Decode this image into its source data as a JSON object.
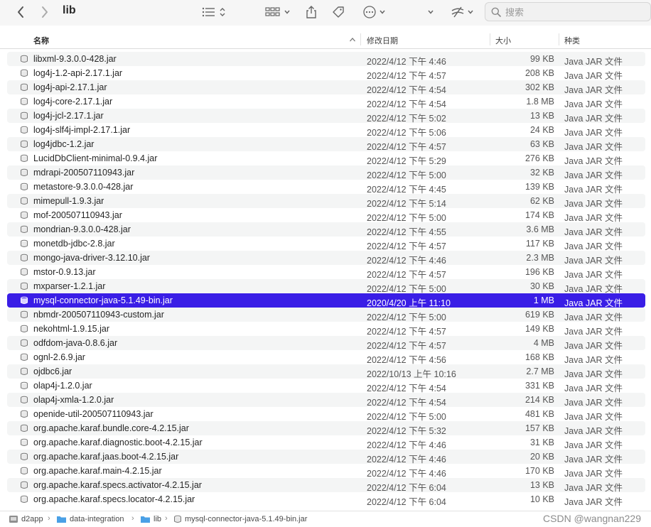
{
  "window": {
    "title": "lib"
  },
  "toolbar": {
    "search_placeholder": "搜索"
  },
  "columns": {
    "name": "名称",
    "date": "修改日期",
    "size": "大小",
    "kind": "种类"
  },
  "files": [
    {
      "name": "libxml-9.3.0.0-428.jar",
      "date": "2022/4/12 下午 4:46",
      "size": "99 KB",
      "kind": "Java JAR 文件"
    },
    {
      "name": "log4j-1.2-api-2.17.1.jar",
      "date": "2022/4/12 下午 4:57",
      "size": "208 KB",
      "kind": "Java JAR 文件"
    },
    {
      "name": "log4j-api-2.17.1.jar",
      "date": "2022/4/12 下午 4:54",
      "size": "302 KB",
      "kind": "Java JAR 文件"
    },
    {
      "name": "log4j-core-2.17.1.jar",
      "date": "2022/4/12 下午 4:54",
      "size": "1.8 MB",
      "kind": "Java JAR 文件"
    },
    {
      "name": "log4j-jcl-2.17.1.jar",
      "date": "2022/4/12 下午 5:02",
      "size": "13 KB",
      "kind": "Java JAR 文件"
    },
    {
      "name": "log4j-slf4j-impl-2.17.1.jar",
      "date": "2022/4/12 下午 5:06",
      "size": "24 KB",
      "kind": "Java JAR 文件"
    },
    {
      "name": "log4jdbc-1.2.jar",
      "date": "2022/4/12 下午 4:57",
      "size": "63 KB",
      "kind": "Java JAR 文件"
    },
    {
      "name": "LucidDbClient-minimal-0.9.4.jar",
      "date": "2022/4/12 下午 5:29",
      "size": "276 KB",
      "kind": "Java JAR 文件"
    },
    {
      "name": "mdrapi-200507110943.jar",
      "date": "2022/4/12 下午 5:00",
      "size": "32 KB",
      "kind": "Java JAR 文件"
    },
    {
      "name": "metastore-9.3.0.0-428.jar",
      "date": "2022/4/12 下午 4:45",
      "size": "139 KB",
      "kind": "Java JAR 文件"
    },
    {
      "name": "mimepull-1.9.3.jar",
      "date": "2022/4/12 下午 5:14",
      "size": "62 KB",
      "kind": "Java JAR 文件"
    },
    {
      "name": "mof-200507110943.jar",
      "date": "2022/4/12 下午 5:00",
      "size": "174 KB",
      "kind": "Java JAR 文件"
    },
    {
      "name": "mondrian-9.3.0.0-428.jar",
      "date": "2022/4/12 下午 4:55",
      "size": "3.6 MB",
      "kind": "Java JAR 文件"
    },
    {
      "name": "monetdb-jdbc-2.8.jar",
      "date": "2022/4/12 下午 4:57",
      "size": "117 KB",
      "kind": "Java JAR 文件"
    },
    {
      "name": "mongo-java-driver-3.12.10.jar",
      "date": "2022/4/12 下午 4:46",
      "size": "2.3 MB",
      "kind": "Java JAR 文件"
    },
    {
      "name": "mstor-0.9.13.jar",
      "date": "2022/4/12 下午 4:57",
      "size": "196 KB",
      "kind": "Java JAR 文件"
    },
    {
      "name": "mxparser-1.2.1.jar",
      "date": "2022/4/12 下午 5:00",
      "size": "30 KB",
      "kind": "Java JAR 文件"
    },
    {
      "name": "mysql-connector-java-5.1.49-bin.jar",
      "date": "2020/4/20 上午 11:10",
      "size": "1 MB",
      "kind": "Java JAR 文件",
      "selected": true
    },
    {
      "name": "nbmdr-200507110943-custom.jar",
      "date": "2022/4/12 下午 5:00",
      "size": "619 KB",
      "kind": "Java JAR 文件"
    },
    {
      "name": "nekohtml-1.9.15.jar",
      "date": "2022/4/12 下午 4:57",
      "size": "149 KB",
      "kind": "Java JAR 文件"
    },
    {
      "name": "odfdom-java-0.8.6.jar",
      "date": "2022/4/12 下午 4:57",
      "size": "4 MB",
      "kind": "Java JAR 文件"
    },
    {
      "name": "ognl-2.6.9.jar",
      "date": "2022/4/12 下午 4:56",
      "size": "168 KB",
      "kind": "Java JAR 文件"
    },
    {
      "name": "ojdbc6.jar",
      "date": "2022/10/13 上午 10:16",
      "size": "2.7 MB",
      "kind": "Java JAR 文件"
    },
    {
      "name": "olap4j-1.2.0.jar",
      "date": "2022/4/12 下午 4:54",
      "size": "331 KB",
      "kind": "Java JAR 文件"
    },
    {
      "name": "olap4j-xmla-1.2.0.jar",
      "date": "2022/4/12 下午 4:54",
      "size": "214 KB",
      "kind": "Java JAR 文件"
    },
    {
      "name": "openide-util-200507110943.jar",
      "date": "2022/4/12 下午 5:00",
      "size": "481 KB",
      "kind": "Java JAR 文件"
    },
    {
      "name": "org.apache.karaf.bundle.core-4.2.15.jar",
      "date": "2022/4/12 下午 5:32",
      "size": "157 KB",
      "kind": "Java JAR 文件"
    },
    {
      "name": "org.apache.karaf.diagnostic.boot-4.2.15.jar",
      "date": "2022/4/12 下午 4:46",
      "size": "31 KB",
      "kind": "Java JAR 文件"
    },
    {
      "name": "org.apache.karaf.jaas.boot-4.2.15.jar",
      "date": "2022/4/12 下午 4:46",
      "size": "20 KB",
      "kind": "Java JAR 文件"
    },
    {
      "name": "org.apache.karaf.main-4.2.15.jar",
      "date": "2022/4/12 下午 4:46",
      "size": "170 KB",
      "kind": "Java JAR 文件"
    },
    {
      "name": "org.apache.karaf.specs.activator-4.2.15.jar",
      "date": "2022/4/12 下午 6:04",
      "size": "13 KB",
      "kind": "Java JAR 文件"
    },
    {
      "name": "org.apache.karaf.specs.locator-4.2.15.jar",
      "date": "2022/4/12 下午 6:04",
      "size": "10 KB",
      "kind": "Java JAR 文件"
    }
  ],
  "pathbar": {
    "items": [
      "d2app",
      "data-integration",
      "lib",
      "mysql-connector-java-5.1.49-bin.jar"
    ],
    "watermark": "CSDN @wangnan229"
  },
  "colors": {
    "selection": "#3a1ee6",
    "folder": "#4aa0e6",
    "alt_row": "#f4f5f5"
  },
  "icons": [
    "back-icon",
    "forward-icon",
    "list-view-icon",
    "sort-icon",
    "grid-view-icon",
    "share-icon",
    "tag-icon",
    "more-icon",
    "chevron-down-icon",
    "sync-icon",
    "search-icon",
    "jar-file-icon",
    "folder-icon",
    "disk-icon"
  ]
}
